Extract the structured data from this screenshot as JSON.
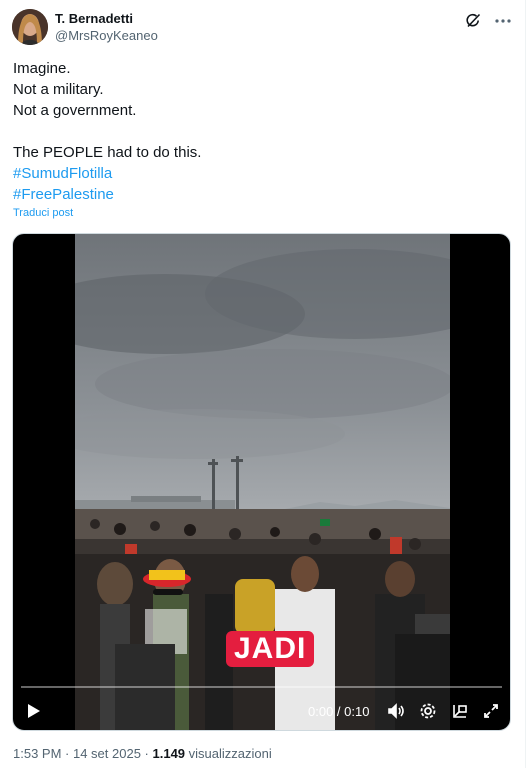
{
  "author": {
    "display_name": "T. Bernadetti",
    "handle": "@MrsRoyKeaneo"
  },
  "header_icons": [
    "grok-icon",
    "more-icon"
  ],
  "tweet": {
    "lines": [
      "Imagine.",
      "Not a military.",
      "Not a government."
    ],
    "line4": "The PEOPLE had to do this.",
    "hashtags": [
      "#SumudFlotilla",
      "#FreePalestine"
    ],
    "translate_label": "Traduci post"
  },
  "video": {
    "caption": "JADI",
    "time_display": "0:00 / 0:10",
    "progress_fraction": 0.0,
    "accent_color": "#1d9bf0",
    "caption_color": "#e41e3f"
  },
  "meta": {
    "time": "1:53 PM",
    "separator": " · ",
    "date": "14 set 2025",
    "views_count": "1.149",
    "views_label": " visualizzazioni"
  }
}
